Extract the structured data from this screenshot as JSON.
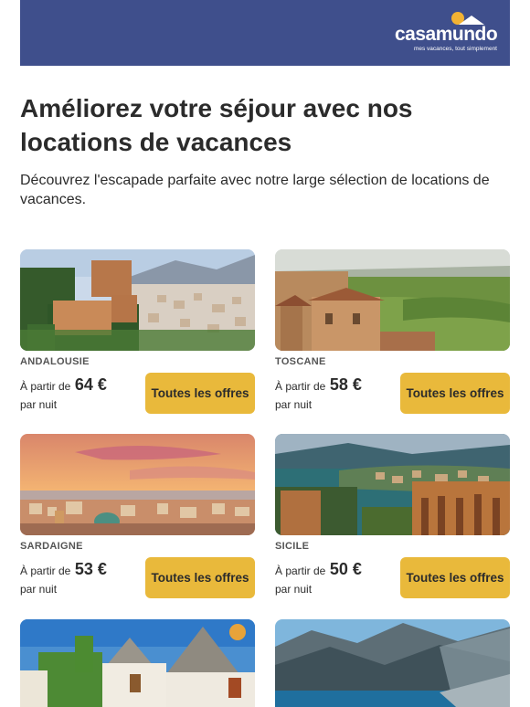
{
  "brand": {
    "name": "casamundo",
    "tagline": "mes vacances, tout simplement"
  },
  "headline": "Améliorez votre séjour avec nos locations de vacances",
  "intro": "Découvrez l'escapade parfaite avec notre large sélection de locations de vacances.",
  "offers": [
    {
      "region": "ANDALOUSIE",
      "from_label": "À partir de",
      "price": "64 €",
      "per_night": "par nuit",
      "cta": "Toutes les offres"
    },
    {
      "region": "TOSCANE",
      "from_label": "À partir de",
      "price": "58 €",
      "per_night": "par nuit",
      "cta": "Toutes les offres"
    },
    {
      "region": "SARDAIGNE",
      "from_label": "À partir de",
      "price": "53 €",
      "per_night": "par nuit",
      "cta": "Toutes les offres"
    },
    {
      "region": "SICILE",
      "from_label": "À partir de",
      "price": "50 €",
      "per_night": "par nuit",
      "cta": "Toutes les offres"
    }
  ],
  "colors": {
    "header_bg": "#3f4f8c",
    "cta_bg": "#e9b93b",
    "logo_sun": "#f2b233"
  }
}
